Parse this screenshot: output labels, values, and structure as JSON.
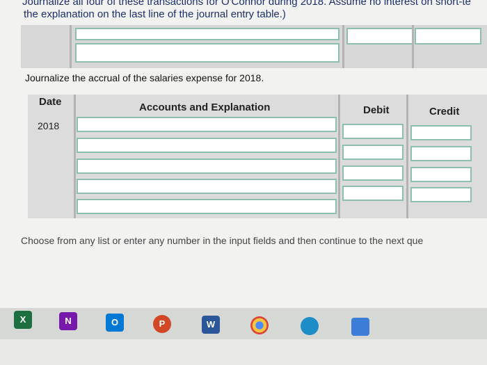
{
  "question": {
    "intro_line0": "Journalize all four of these transactions for O'Connor during 2018. Assume no interest on short-te",
    "intro_line1": "the explanation on the last line of the journal entry table.)"
  },
  "journal_prompt": "Journalize the accrual of the salaries expense for 2018.",
  "journal_table": {
    "headers": {
      "date": "Date",
      "accounts": "Accounts and Explanation",
      "debit": "Debit",
      "credit": "Credit"
    },
    "date_value": "2018"
  },
  "footer_note": "Choose from any list or enter any number in the input fields and then continue to the next que",
  "taskbar": [
    {
      "name": "excel-icon",
      "label": "X",
      "color": "#1d6f42"
    },
    {
      "name": "onenote-icon",
      "label": "N",
      "color": "#7719aa"
    },
    {
      "name": "outlook-icon",
      "label": "O",
      "color": "#0078d4"
    },
    {
      "name": "powerpoint-icon",
      "label": "P",
      "color": "#d24726"
    },
    {
      "name": "word-icon",
      "label": "W",
      "color": "#2b579a"
    },
    {
      "name": "chrome-icon",
      "label": "",
      "color": "#f5c542"
    },
    {
      "name": "edge-icon",
      "label": "",
      "color": "#1e8cc7"
    },
    {
      "name": "photos-icon",
      "label": "",
      "color": "#3b7dd8"
    }
  ]
}
